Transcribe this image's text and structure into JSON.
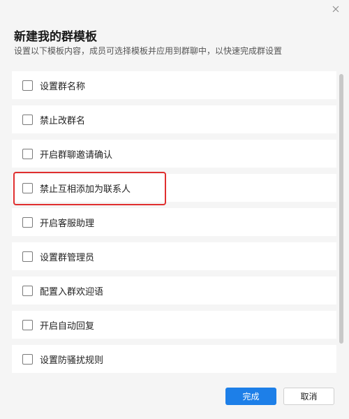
{
  "dialog": {
    "title": "新建我的群模板",
    "subtitle": "设置以下模板内容，成员可选择模板并应用到群聊中，以快速完成群设置"
  },
  "options": [
    {
      "label": "设置群名称",
      "checked": false
    },
    {
      "label": "禁止改群名",
      "checked": false
    },
    {
      "label": "开启群聊邀请确认",
      "checked": false
    },
    {
      "label": "禁止互相添加为联系人",
      "checked": false,
      "highlighted": true
    },
    {
      "label": "开启客服助理",
      "checked": false
    },
    {
      "label": "设置群管理员",
      "checked": false
    },
    {
      "label": "配置入群欢迎语",
      "checked": false
    },
    {
      "label": "开启自动回复",
      "checked": false
    },
    {
      "label": "设置防骚扰规则",
      "checked": false
    }
  ],
  "buttons": {
    "confirm_label": "完成",
    "cancel_label": "取消"
  },
  "colors": {
    "accent": "#1d7fe8",
    "highlight": "#e02f2f"
  },
  "icons": {
    "close": "close-icon"
  }
}
